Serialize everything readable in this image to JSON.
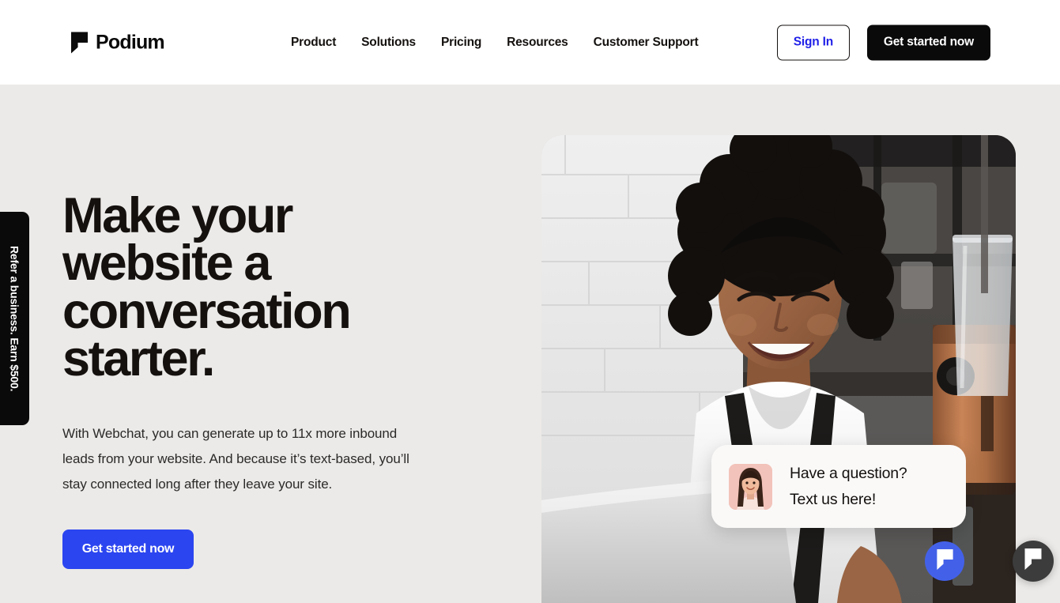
{
  "brand": {
    "name": "Podium",
    "logo_icon": "podium-speech-bubble-mark",
    "accent_blue": "#2B45F0",
    "link_blue": "#1F1FE8",
    "ink": "#14110F",
    "page_background": "#ECEAE8"
  },
  "header": {
    "nav": [
      {
        "label": "Product"
      },
      {
        "label": "Solutions"
      },
      {
        "label": "Pricing"
      },
      {
        "label": "Resources"
      },
      {
        "label": "Customer Support"
      }
    ],
    "sign_in_label": "Sign In",
    "cta_label": "Get started now"
  },
  "referral_tab": {
    "label": "Refer a business. Earn $500.",
    "background": "#0A0A0A"
  },
  "hero": {
    "title": "Make your website a conversation starter.",
    "subtitle": "With Webchat, you can generate up to 11x more inbound leads from your website. And because it’s text-based, you’ll stay connected long after they leave your site.",
    "cta_label": "Get started now",
    "image_alt": "Smiling woman in white shirt and black apron working on a laptop in a coffee shop"
  },
  "chat_bubble": {
    "line1": "Have a question?",
    "line2": "Text us here!",
    "avatar_icon": "person-avatar",
    "avatar_background": "#F2C3BA"
  },
  "widgets": {
    "webchat_blue": {
      "icon": "podium-chat-icon",
      "color": "#4361E8"
    },
    "webchat_dark": {
      "icon": "podium-chat-icon",
      "color": "#3C3C3C"
    }
  }
}
